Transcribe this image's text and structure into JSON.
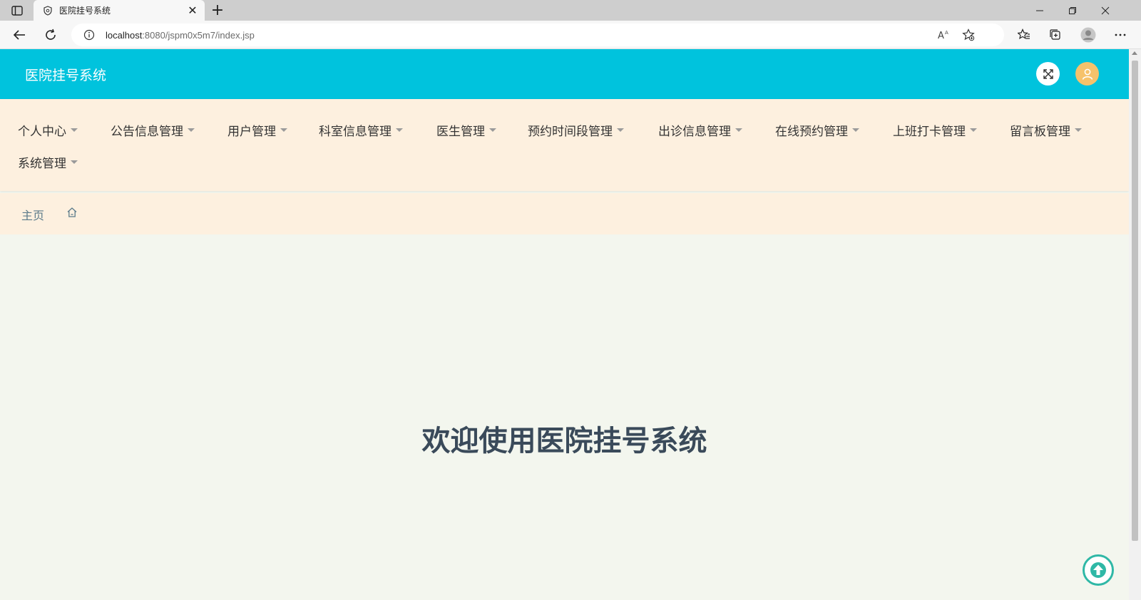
{
  "browser": {
    "tab_title": "医院挂号系统",
    "url_host": "localhost",
    "url_path": ":8080/jspm0x5m7/index.jsp"
  },
  "header": {
    "brand": "医院挂号系统"
  },
  "menu": {
    "items": [
      {
        "label": "个人中心"
      },
      {
        "label": "公告信息管理"
      },
      {
        "label": "用户管理"
      },
      {
        "label": "科室信息管理"
      },
      {
        "label": "医生管理"
      },
      {
        "label": "预约时间段管理"
      },
      {
        "label": "出诊信息管理"
      },
      {
        "label": "在线预约管理"
      },
      {
        "label": "上班打卡管理"
      },
      {
        "label": "留言板管理"
      },
      {
        "label": "系统管理"
      }
    ]
  },
  "breadcrumb": {
    "home_label": "主页"
  },
  "main": {
    "welcome": "欢迎使用医院挂号系统"
  },
  "colors": {
    "header_bg": "#00c3dd",
    "menu_bg": "#fdf0df",
    "page_bg": "#f3f6ee",
    "avatar_bg": "#f6c26b",
    "back_top_accent": "#2fb8a6"
  },
  "icons": {
    "fullscreen": "expand-icon",
    "user": "user-icon",
    "home": "home-icon",
    "back_to_top": "arrow-up-circle-icon"
  }
}
